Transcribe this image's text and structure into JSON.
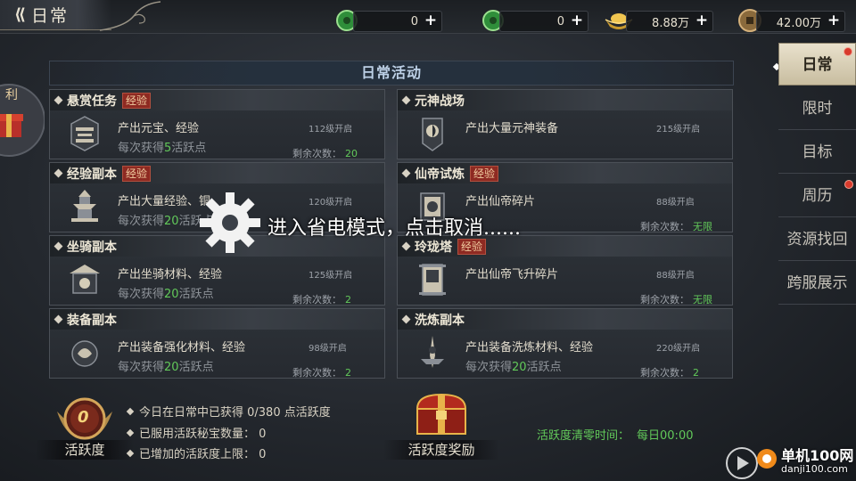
{
  "header": {
    "title": "日常",
    "back_icon": "back-arrow-icon"
  },
  "resources": [
    {
      "icon": "green-jade-icon",
      "value": "0"
    },
    {
      "icon": "green-jade-bound-icon",
      "value": "0"
    },
    {
      "icon": "gold-ingot-icon",
      "value": "8.88万"
    },
    {
      "icon": "copper-coin-icon",
      "value": "42.00万"
    }
  ],
  "panel": {
    "title": "日常活动"
  },
  "cards": [
    {
      "name": "悬赏任务",
      "tag": "经验",
      "desc": "产出元宝、经验",
      "sub_prefix": "每次获得",
      "sub_num": "5",
      "sub_suffix": "活跃点",
      "level": "112级开启",
      "remain_label": "剩余次数：",
      "remain_value": "20",
      "icon": "bounty-scroll-icon"
    },
    {
      "name": "元神战场",
      "tag": "",
      "desc": "产出大量元神装备",
      "sub_prefix": "",
      "sub_num": "",
      "sub_suffix": "",
      "level": "215级开启",
      "remain_label": "",
      "remain_value": "",
      "icon": "soul-battle-icon"
    },
    {
      "name": "经验副本",
      "tag": "经验",
      "desc": "产出大量经验、铜",
      "sub_prefix": "每次获得",
      "sub_num": "20",
      "sub_suffix": "活跃点",
      "level": "120级开启",
      "remain_label": "",
      "remain_value": "",
      "icon": "pagoda-icon"
    },
    {
      "name": "仙帝试炼",
      "tag": "经验",
      "desc": "产出仙帝碎片",
      "sub_prefix": "",
      "sub_num": "",
      "sub_suffix": "",
      "level": "88级开启",
      "remain_label": "剩余次数：",
      "remain_value": "无限",
      "icon": "immortal-trial-icon"
    },
    {
      "name": "坐骑副本",
      "tag": "",
      "desc": "产出坐骑材料、经验",
      "sub_prefix": "每次获得",
      "sub_num": "20",
      "sub_suffix": "活跃点",
      "level": "125级开启",
      "remain_label": "剩余次数：",
      "remain_value": "2",
      "icon": "mount-pavilion-icon"
    },
    {
      "name": "玲珑塔",
      "tag": "经验",
      "desc": "产出仙帝飞升碎片",
      "sub_prefix": "",
      "sub_num": "",
      "sub_suffix": "",
      "level": "88级开启",
      "remain_label": "剩余次数：",
      "remain_value": "无限",
      "icon": "tower-scroll-icon"
    },
    {
      "name": "装备副本",
      "tag": "",
      "desc": "产出装备强化材料、经验",
      "sub_prefix": "每次获得",
      "sub_num": "20",
      "sub_suffix": "活跃点",
      "level": "98级开启",
      "remain_label": "剩余次数：",
      "remain_value": "2",
      "icon": "equipment-icon"
    },
    {
      "name": "洗炼副本",
      "tag": "",
      "desc": "产出装备洗炼材料、经验",
      "sub_prefix": "每次获得",
      "sub_num": "20",
      "sub_suffix": "活跃点",
      "level": "220级开启",
      "remain_label": "剩余次数：",
      "remain_value": "2",
      "icon": "refine-weapon-icon"
    }
  ],
  "sidebar": [
    {
      "label": "日常",
      "active": true,
      "red_dot": true
    },
    {
      "label": "限时",
      "active": false,
      "red_dot": false
    },
    {
      "label": "目标",
      "active": false,
      "red_dot": false
    },
    {
      "label": "周历",
      "active": false,
      "red_dot": true
    },
    {
      "label": "资源找回",
      "active": false,
      "red_dot": false
    },
    {
      "label": "跨服展示",
      "active": false,
      "red_dot": false
    }
  ],
  "left_tab": {
    "label": "利"
  },
  "activity": {
    "value": "0",
    "label": "活跃度"
  },
  "info_lines": [
    "今日在日常中已获得 0/380 点活跃度",
    "已服用活跃秘宝数量： 0",
    "已增加的活跃度上限： 0"
  ],
  "reward": {
    "label": "活跃度奖励"
  },
  "reset": {
    "label": "活跃度清零时间：",
    "value": "每日00:00"
  },
  "toast": {
    "text": "进入省电模式，点击取消......"
  },
  "watermark": {
    "name": "单机100网",
    "url": "danji100.com"
  },
  "colors": {
    "accent_green": "#62c95a",
    "tag_red": "#8e2a22",
    "title_blue": "#bdd0e6",
    "active_tab": "#e9e1cc"
  }
}
